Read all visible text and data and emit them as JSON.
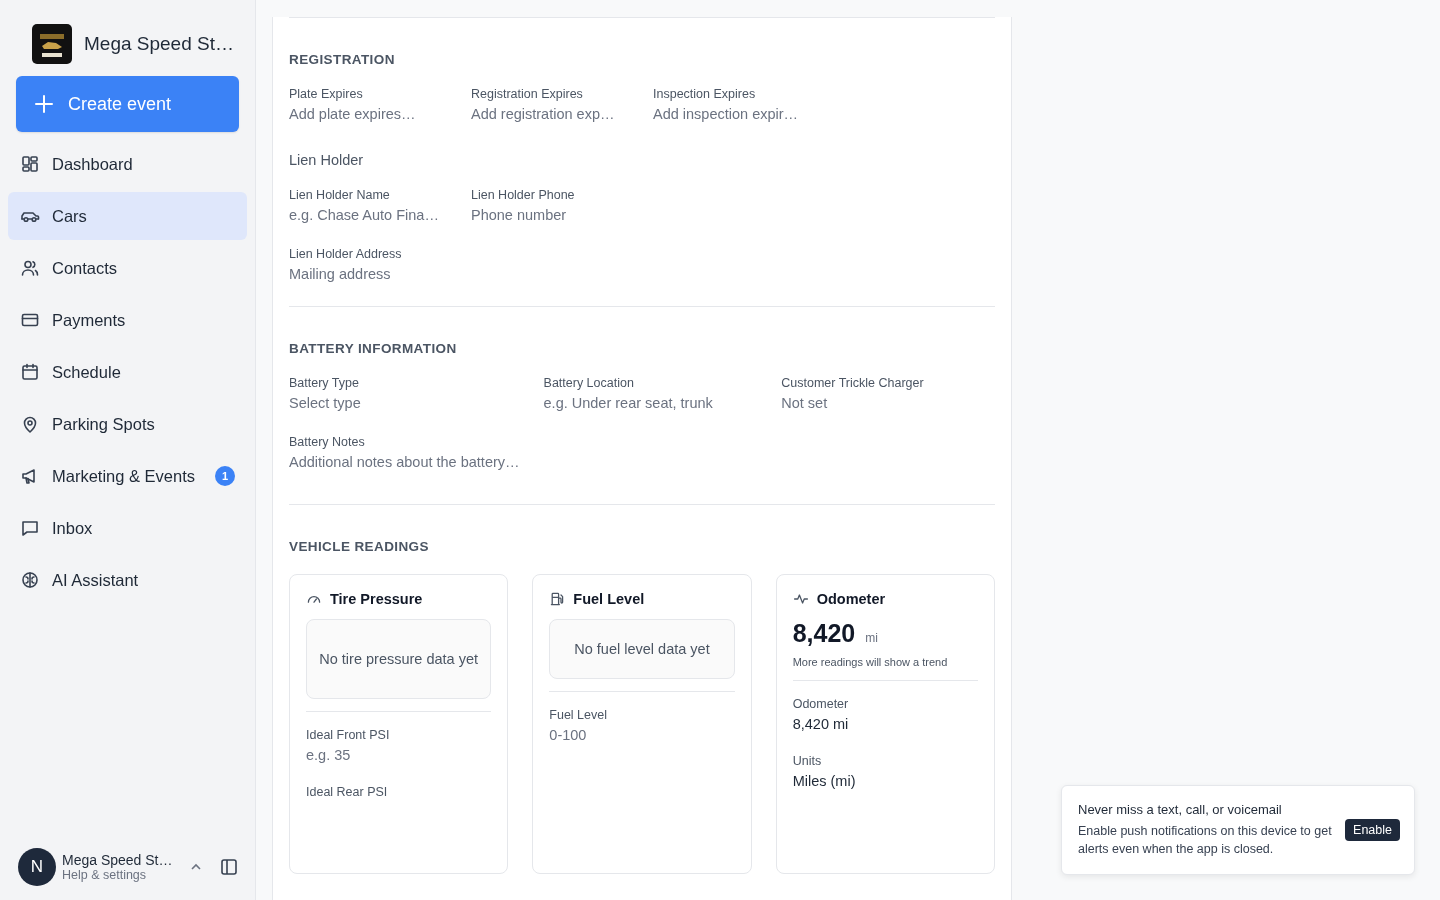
{
  "sidebar": {
    "brand": "Mega Speed St…",
    "create_button": "Create event",
    "items": [
      {
        "label": "Dashboard",
        "selected": false
      },
      {
        "label": "Cars",
        "selected": true
      },
      {
        "label": "Contacts",
        "selected": false
      },
      {
        "label": "Payments",
        "selected": false
      },
      {
        "label": "Schedule",
        "selected": false
      },
      {
        "label": "Parking Spots",
        "selected": false
      },
      {
        "label": "Marketing & Events",
        "selected": false,
        "badge": "1"
      },
      {
        "label": "Inbox",
        "selected": false
      },
      {
        "label": "AI Assistant",
        "selected": false
      }
    ],
    "account": {
      "avatar": "N",
      "name": "Mega Speed St…",
      "subtitle": "Help & settings"
    }
  },
  "registration": {
    "title": "REGISTRATION",
    "rows": [
      [
        {
          "label": "Plate Expires",
          "placeholder": "Add plate expires…"
        },
        {
          "label": "Registration Expires",
          "placeholder": "Add registration exp…"
        },
        {
          "label": "Inspection Expires",
          "placeholder": "Add inspection expir…"
        }
      ]
    ],
    "subheading": "Lien Holder",
    "sub_rows": [
      [
        {
          "label": "Lien Holder Name",
          "placeholder": "e.g. Chase Auto Fina…"
        },
        {
          "label": "Lien Holder Phone",
          "placeholder": "Phone number"
        }
      ],
      [
        {
          "label": "Lien Holder Address",
          "placeholder": "Mailing address"
        }
      ]
    ]
  },
  "battery": {
    "title": "BATTERY INFORMATION",
    "fields": [
      {
        "label": "Battery Type",
        "placeholder": "Select type"
      },
      {
        "label": "Battery Location",
        "placeholder": "e.g. Under rear seat, trunk"
      },
      {
        "label": "Customer Trickle Charger",
        "placeholder": "Not set"
      },
      {
        "label": "Battery Notes",
        "placeholder": "Additional notes about the battery…"
      }
    ]
  },
  "vehicle_readings": {
    "title": "VEHICLE READINGS",
    "cards": [
      {
        "kind": "empty",
        "title": "Tire Pressure",
        "empty_text": "No tire pressure data yet",
        "fields": [
          {
            "label": "Ideal Front PSI",
            "placeholder": "e.g. 35"
          },
          {
            "label": "Ideal Rear PSI"
          }
        ]
      },
      {
        "kind": "empty",
        "title": "Fuel Level",
        "empty_text": "No fuel level data yet",
        "fields": [
          {
            "label": "Fuel Level",
            "placeholder": "0-100"
          }
        ]
      },
      {
        "kind": "reading",
        "title": "Odometer",
        "reading": "8,420",
        "unit": "mi",
        "note": "More readings will show a trend",
        "fields": [
          {
            "label": "Odometer",
            "value": "8,420 mi"
          },
          {
            "label": "Units",
            "value": "Miles (mi)"
          }
        ]
      }
    ]
  },
  "toast": {
    "title": "Never miss a text, call, or voicemail",
    "body": "Enable push notifications on this device to get alerts even when the app is closed.",
    "button": "Enable"
  }
}
